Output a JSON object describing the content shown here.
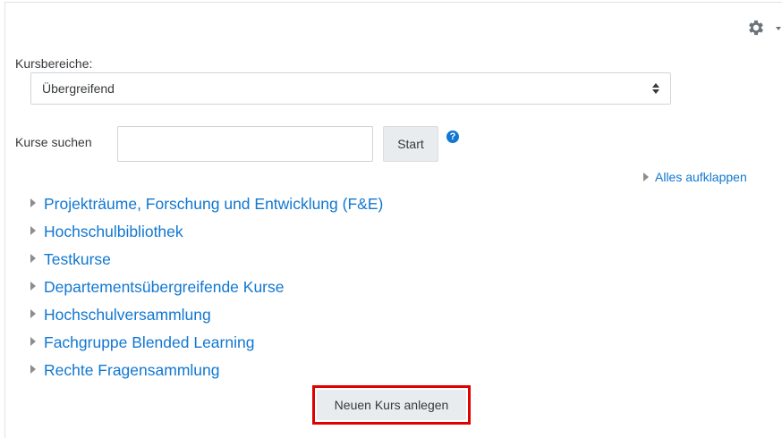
{
  "toolbar": {
    "settings_icon": "gear-icon"
  },
  "category_select": {
    "label": "Kursbereiche:",
    "selected": "Übergreifend"
  },
  "course_search": {
    "label": "Kurse suchen",
    "value": "",
    "placeholder": "",
    "button_label": "Start",
    "help_icon": "?"
  },
  "expand_all_label": "Alles aufklappen",
  "categories": [
    {
      "label": "Projekträume, Forschung und Entwicklung (F&E)"
    },
    {
      "label": "Hochschulbibliothek"
    },
    {
      "label": "Testkurse"
    },
    {
      "label": "Departementsübergreifende Kurse"
    },
    {
      "label": "Hochschulversammlung"
    },
    {
      "label": "Fachgruppe Blended Learning"
    },
    {
      "label": "Rechte Fragensammlung"
    }
  ],
  "new_course_button": "Neuen Kurs anlegen",
  "colors": {
    "link": "#1177d1",
    "highlight_border": "#e00000",
    "button_bg": "#e9ecef"
  }
}
